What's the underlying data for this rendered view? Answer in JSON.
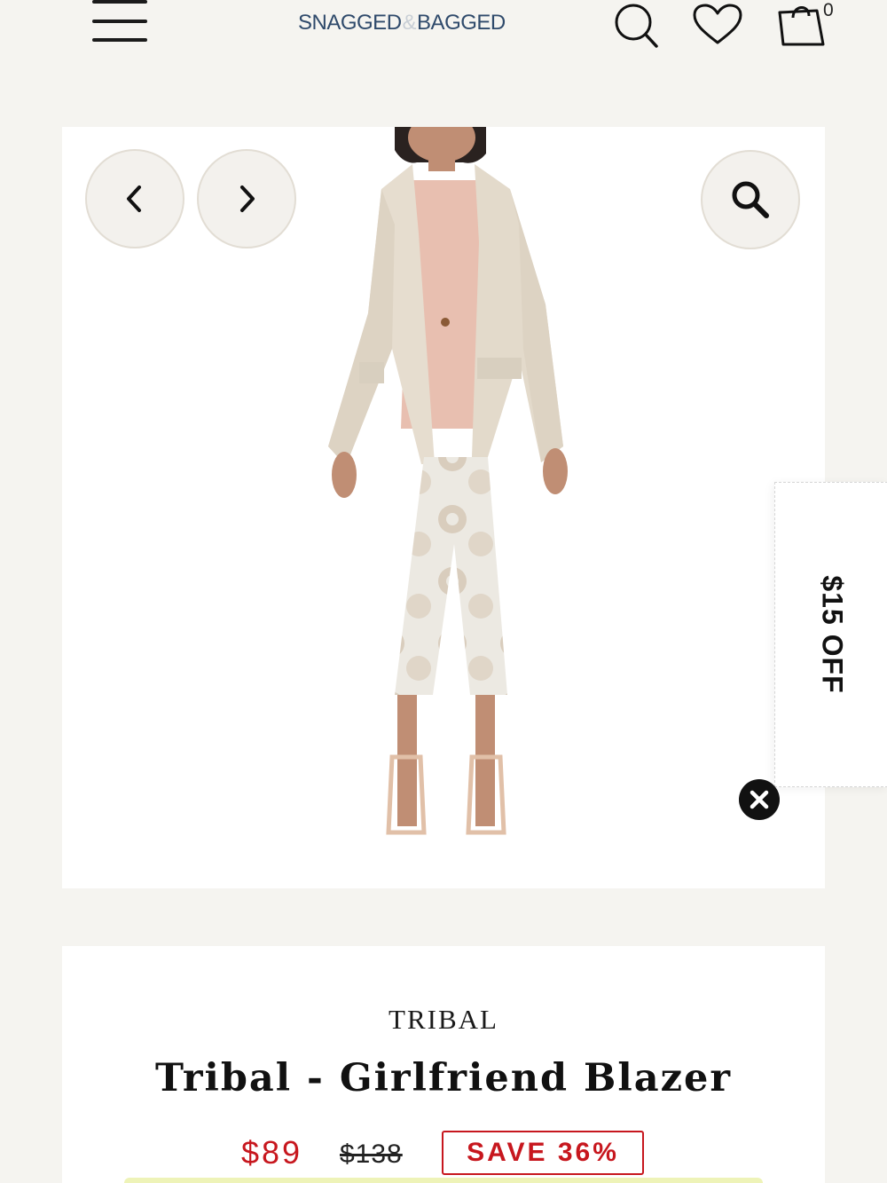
{
  "header": {
    "logo": {
      "left": "SNAGGED",
      "amp": "&",
      "right": "BAGGED"
    },
    "cart_count": "0",
    "icons": [
      "menu-icon",
      "search-icon",
      "heart-icon",
      "cart-icon"
    ]
  },
  "gallery": {
    "image_alt": "Model wearing a beige linen girlfriend blazer, pink top and printed cropped pants",
    "controls": [
      "chevron-left-icon",
      "chevron-right-icon",
      "zoom-icon"
    ]
  },
  "promo": {
    "label": "$15 OFF",
    "close_icon": "close-icon"
  },
  "product": {
    "brand": "TRIBAL",
    "title": "Tribal - Girlfriend Blazer",
    "price": "$89",
    "compare_price": "$138",
    "save_label": "SAVE 36%"
  },
  "colors": {
    "background": "#f5f4f0",
    "logo": "#2f4a6b",
    "sale_red": "#c7171e"
  }
}
